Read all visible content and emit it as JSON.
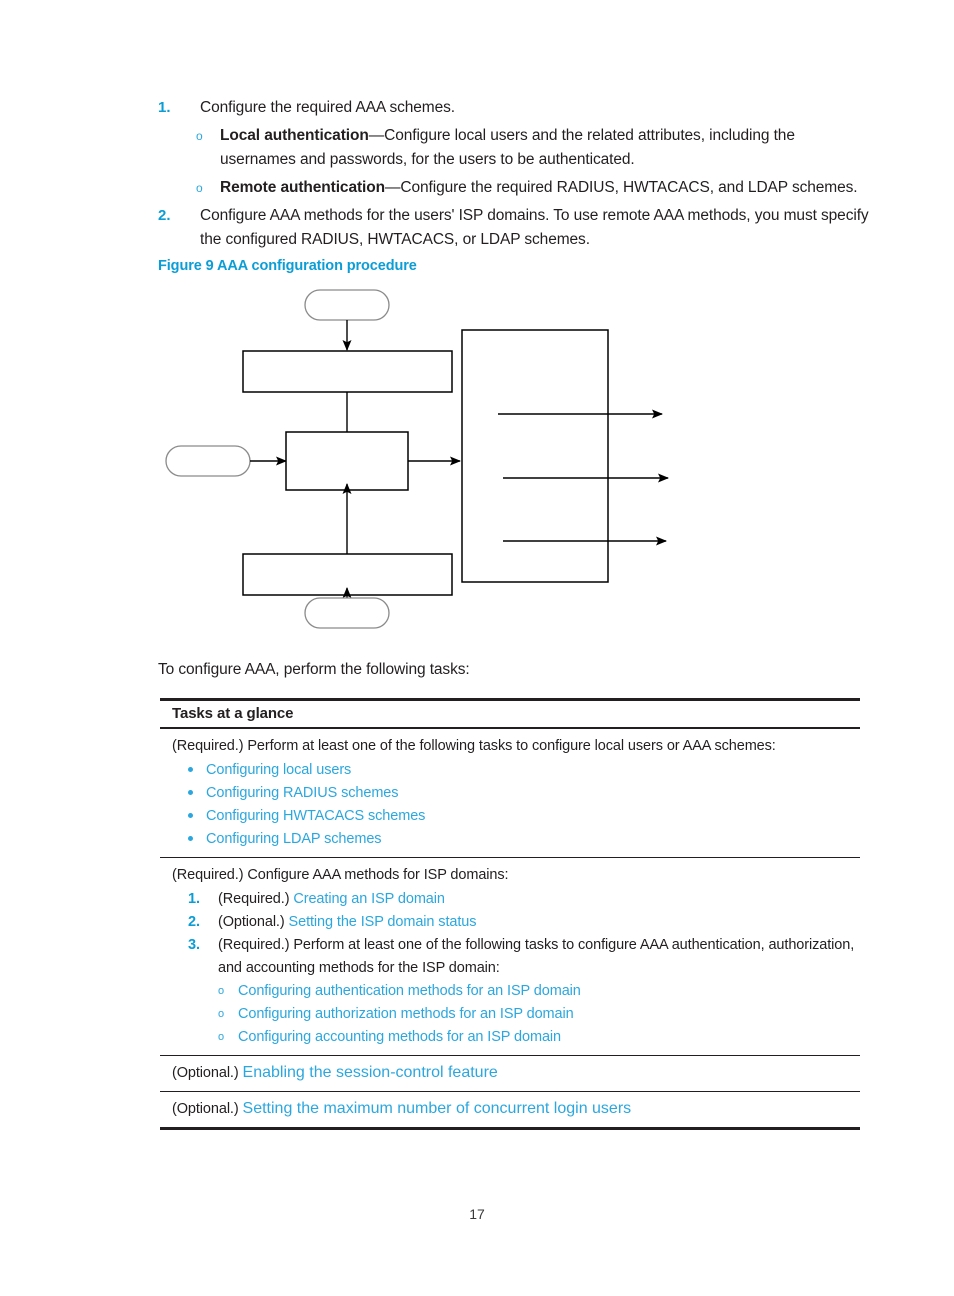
{
  "intro": {
    "items": [
      {
        "marker": "1.",
        "text": "Configure the required AAA schemes.",
        "subitems": [
          {
            "marker": "o",
            "bold": "Local authentication",
            "text": "—Configure local users and the related attributes, including the usernames and passwords, for the users to be authenticated."
          },
          {
            "marker": "o",
            "bold": "Remote authentication",
            "text": "—Configure the required RADIUS, HWTACACS, and LDAP schemes."
          }
        ]
      },
      {
        "marker": "2.",
        "text": "Configure AAA methods for the users' ISP domains. To use remote AAA methods, you must specify the configured RADIUS, HWTACACS, or LDAP schemes.",
        "subitems": []
      }
    ]
  },
  "figure": {
    "caption": "Figure 9 AAA configuration procedure",
    "shapes": {
      "top_terminator": "",
      "top_box": "",
      "left_terminator": "",
      "center_box": "",
      "bottom_box": "",
      "bottom_terminator": "",
      "right_box": ""
    }
  },
  "lead_sentence": "To configure AAA, perform the following tasks:",
  "tasks_table": {
    "header": "Tasks at a glance",
    "rows": [
      {
        "lead": "(Required.) Perform at least one of the following tasks to configure local users or AAA schemes:",
        "bullets": [
          "Configuring local users",
          "Configuring RADIUS schemes",
          "Configuring HWTACACS schemes",
          "Configuring LDAP schemes"
        ]
      },
      {
        "lead": "(Required.) Configure AAA methods for ISP domains:",
        "ordered": [
          {
            "marker": "1.",
            "prefix": "(Required.) ",
            "link": "Creating an ISP domain"
          },
          {
            "marker": "2.",
            "prefix": "(Optional.) ",
            "link": "Setting the ISP domain status"
          },
          {
            "marker": "3.",
            "prefix": "(Required.) Perform at least one of the following tasks to configure AAA authentication, authorization, and accounting methods for the ISP domain:",
            "link": "",
            "subitems": [
              {
                "marker": "o",
                "link": "Configuring authentication methods for an ISP domain"
              },
              {
                "marker": "o",
                "link": "Configuring authorization methods for an ISP domain"
              },
              {
                "marker": "o",
                "link": "Configuring accounting methods for an ISP domain"
              }
            ]
          }
        ]
      },
      {
        "prefix": "(Optional.) ",
        "link": "Enabling the session-control feature"
      },
      {
        "prefix": "(Optional.) ",
        "link": "Setting the maximum number of concurrent login users"
      }
    ]
  },
  "footer": {
    "page_number": "17"
  },
  "colors": {
    "heading_blue": "#0b9dd6",
    "link_blue": "#2BA7DF",
    "text": "#231f20",
    "rule": "#231f20",
    "terminator_stroke": "#8a8a8a"
  }
}
